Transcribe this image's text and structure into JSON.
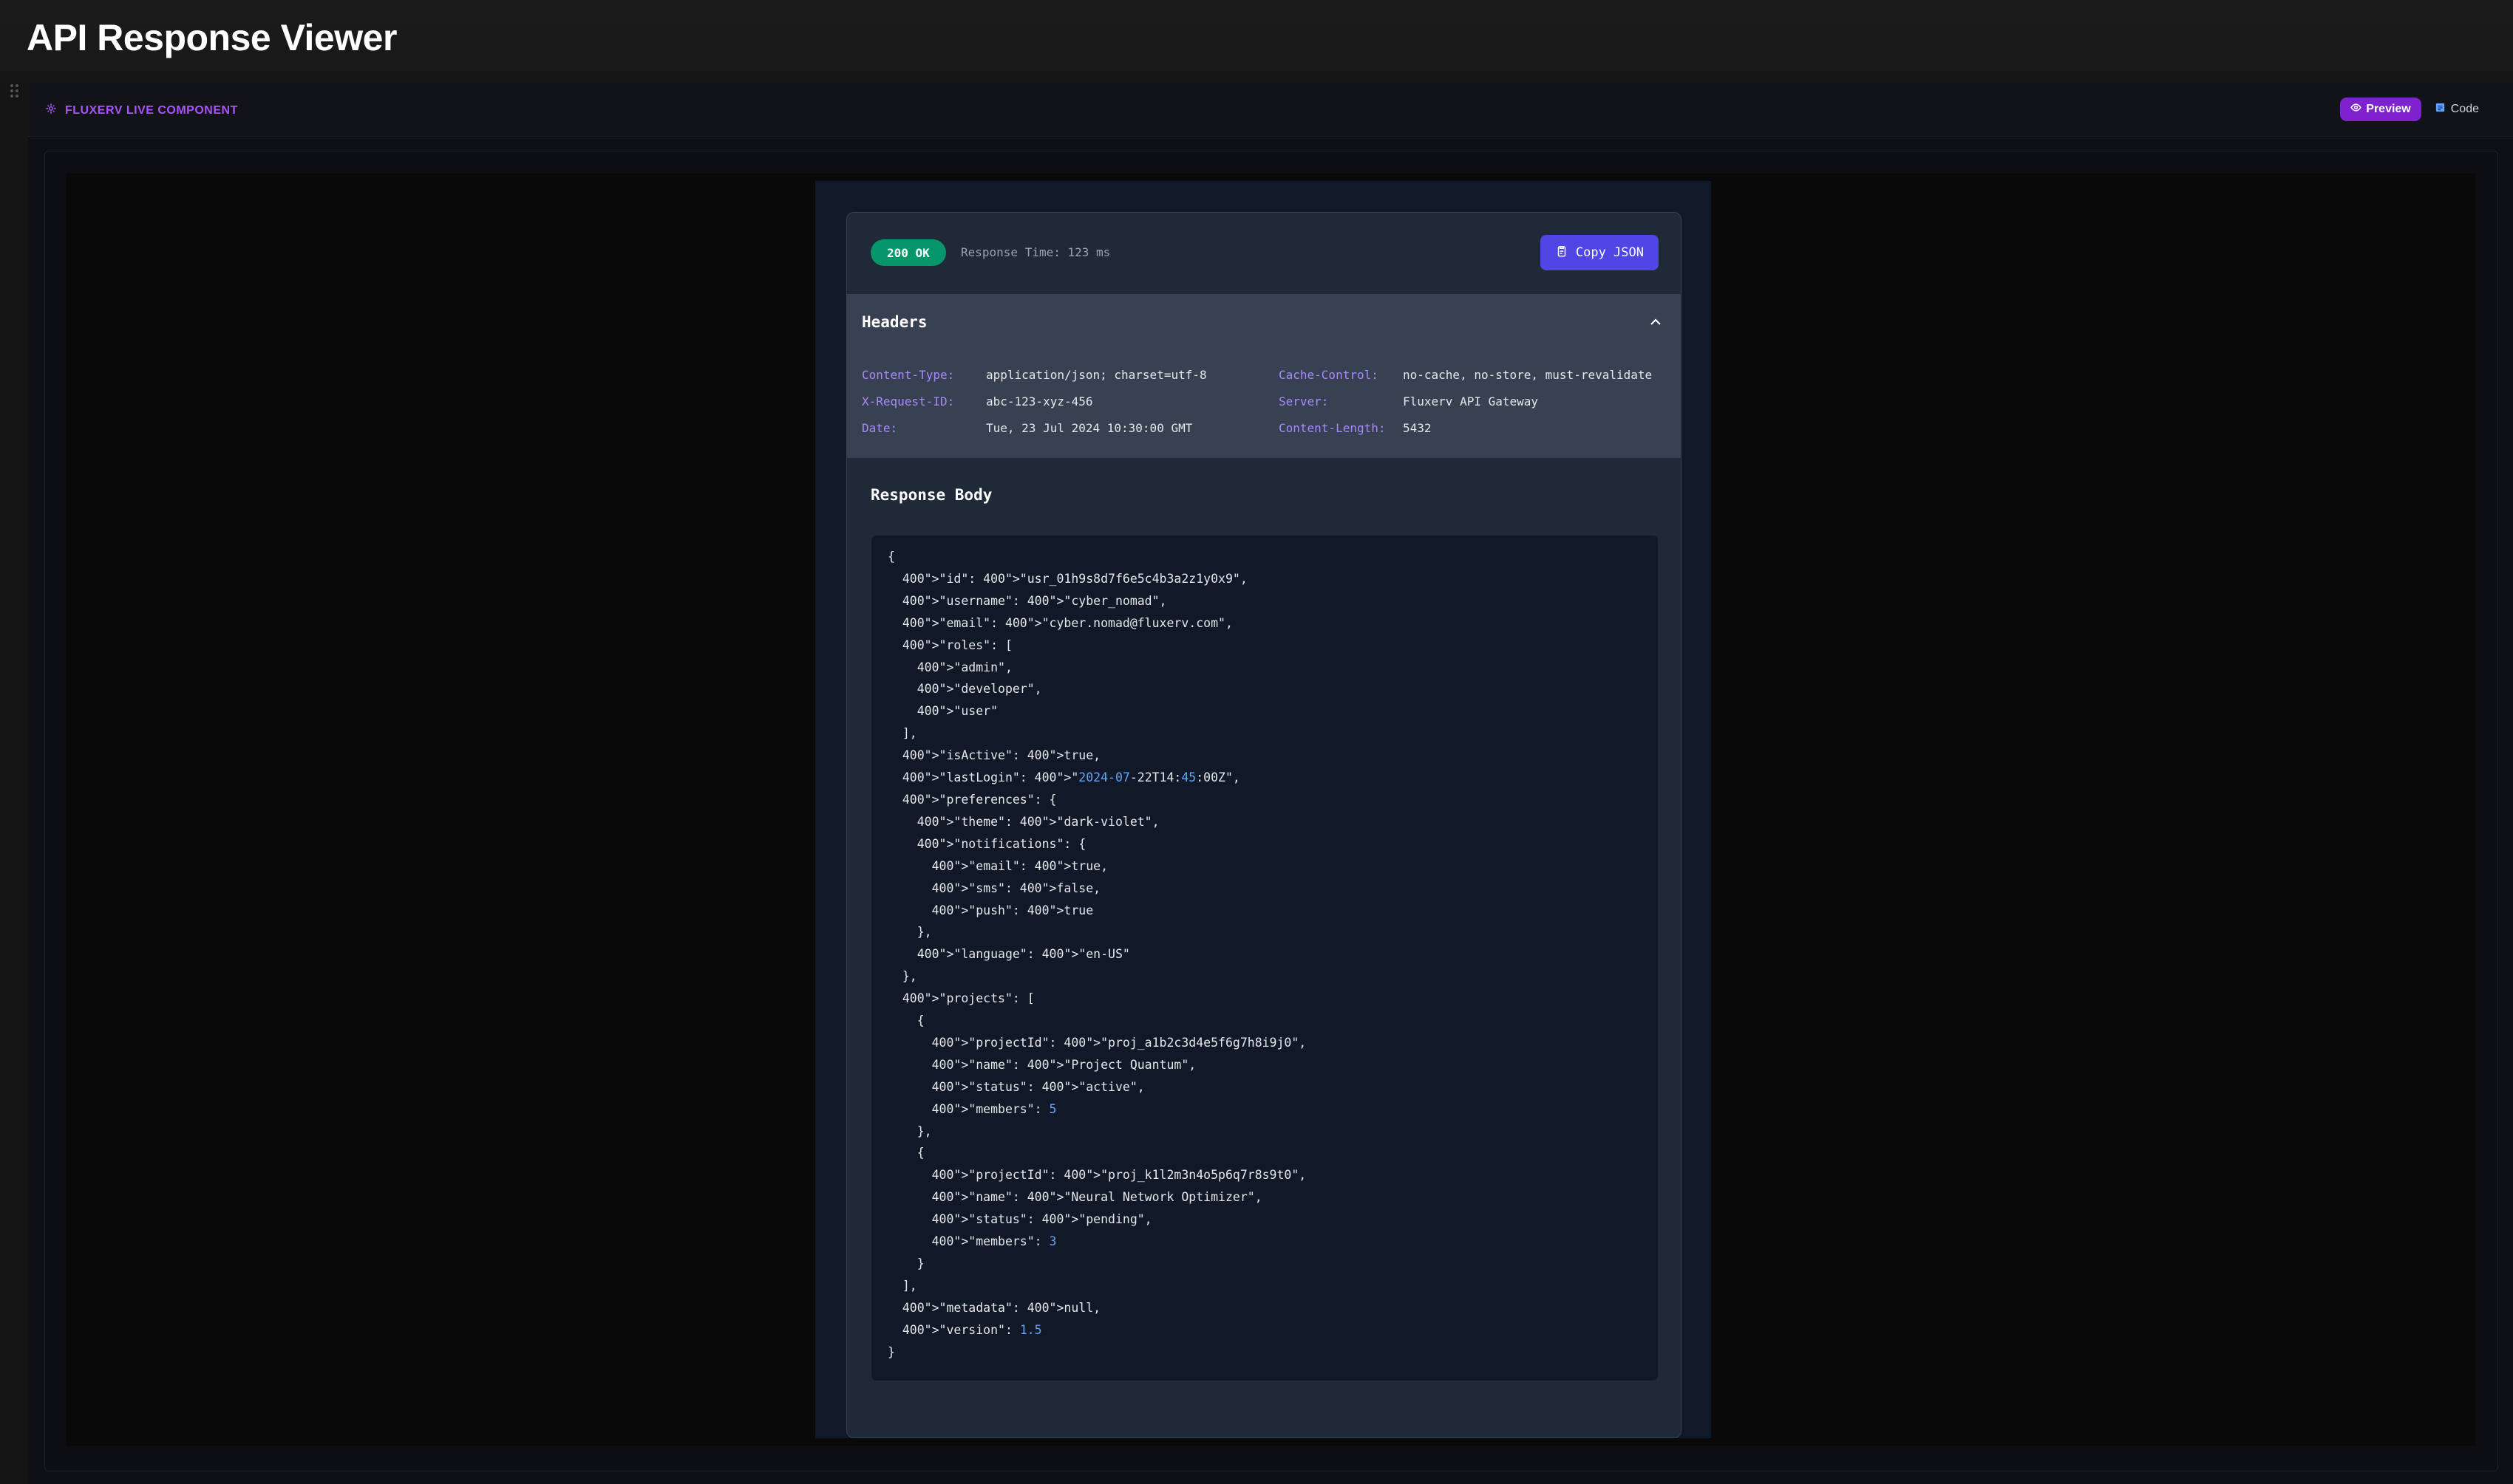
{
  "app": {
    "title": "API Response Viewer"
  },
  "panel": {
    "component_label": "FLUXERV LIVE COMPONENT",
    "preview_label": "Preview",
    "code_label": "Code"
  },
  "response": {
    "status": "200 OK",
    "status_color": "#059669",
    "response_time": "Response Time: 123 ms",
    "copy_label": "Copy JSON"
  },
  "headers": {
    "title": "Headers",
    "items": [
      {
        "key": "Content-Type:",
        "value": "application/json; charset=utf-8"
      },
      {
        "key": "Cache-Control:",
        "value": "no-cache, no-store, must-revalidate"
      },
      {
        "key": "X-Request-ID:",
        "value": "abc-123-xyz-456"
      },
      {
        "key": "Server:",
        "value": "Fluxerv API Gateway"
      },
      {
        "key": "Date:",
        "value": "Tue, 23 Jul 2024 10:30:00 GMT"
      },
      {
        "key": "Content-Length:",
        "value": "5432"
      }
    ]
  },
  "body": {
    "title": "Response Body",
    "lines": [
      {
        "text": "{"
      },
      {
        "text": "  400\">\"id\": 400\">\"usr_01h9s8d7f6e5c4b3a2z1y0x9\","
      },
      {
        "text": "  400\">\"username\": 400\">\"cyber_nomad\","
      },
      {
        "text": "  400\">\"email\": 400\">\"cyber.nomad@fluxerv.com\","
      },
      {
        "text": "  400\">\"roles\": ["
      },
      {
        "text": "    400\">\"admin\","
      },
      {
        "text": "    400\">\"developer\","
      },
      {
        "text": "    400\">\"user\""
      },
      {
        "text": "  ],"
      },
      {
        "text": "  400\">\"isActive\": 400\">true,"
      },
      {
        "pre": "  400\">\"lastLogin\": 400\">\"",
        "n1": "2024-07",
        "mid": "-22T14:",
        "n2": "45",
        "post": ":00Z\","
      },
      {
        "text": "  400\">\"preferences\": {"
      },
      {
        "text": "    400\">\"theme\": 400\">\"dark-violet\","
      },
      {
        "text": "    400\">\"notifications\": {"
      },
      {
        "text": "      400\">\"email\": 400\">true,"
      },
      {
        "text": "      400\">\"sms\": 400\">false,"
      },
      {
        "text": "      400\">\"push\": 400\">true"
      },
      {
        "text": "    },"
      },
      {
        "text": "    400\">\"language\": 400\">\"en-US\""
      },
      {
        "text": "  },"
      },
      {
        "text": "  400\">\"projects\": ["
      },
      {
        "text": "    {"
      },
      {
        "text": "      400\">\"projectId\": 400\">\"proj_a1b2c3d4e5f6g7h8i9j0\","
      },
      {
        "text": "      400\">\"name\": 400\">\"Project Quantum\","
      },
      {
        "text": "      400\">\"status\": 400\">\"active\","
      },
      {
        "pre": "      400\">\"members\": ",
        "n1": "5",
        "mid": "",
        "n2": "",
        "post": ""
      },
      {
        "text": "    },"
      },
      {
        "text": "    {"
      },
      {
        "text": "      400\">\"projectId\": 400\">\"proj_k1l2m3n4o5p6q7r8s9t0\","
      },
      {
        "text": "      400\">\"name\": 400\">\"Neural Network Optimizer\","
      },
      {
        "text": "      400\">\"status\": 400\">\"pending\","
      },
      {
        "pre": "      400\">\"members\": ",
        "n1": "3",
        "mid": "",
        "n2": "",
        "post": ""
      },
      {
        "text": "    }"
      },
      {
        "text": "  ],"
      },
      {
        "text": "  400\">\"metadata\": 400\">null,"
      },
      {
        "pre": "  400\">\"version\": ",
        "n1": "1.5",
        "mid": "",
        "n2": "",
        "post": ""
      },
      {
        "text": "}"
      }
    ]
  }
}
